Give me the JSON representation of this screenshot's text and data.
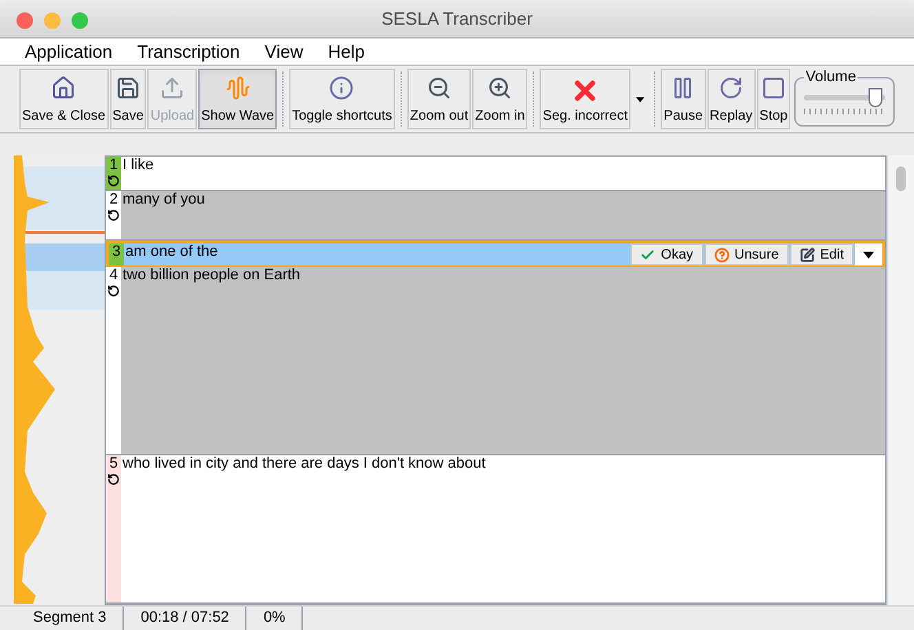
{
  "window": {
    "title": "SESLA Transcriber"
  },
  "menu": [
    "Application",
    "Transcription",
    "View",
    "Help"
  ],
  "toolbar": [
    {
      "label": "Save & Close",
      "disabled": false,
      "selected": false
    },
    {
      "label": "Save",
      "disabled": false,
      "selected": false
    },
    {
      "label": "Upload",
      "disabled": true,
      "selected": false
    },
    {
      "label": "Show Wave",
      "disabled": false,
      "selected": true
    },
    {
      "label": "Toggle shortcuts",
      "disabled": false,
      "selected": false
    },
    {
      "label": "Zoom out",
      "disabled": false,
      "selected": false
    },
    {
      "label": "Zoom in",
      "disabled": false,
      "selected": false
    },
    {
      "label": "Seg. incorrect",
      "disabled": false,
      "selected": false
    },
    {
      "label": "Pause",
      "disabled": false,
      "selected": false
    },
    {
      "label": "Replay",
      "disabled": false,
      "selected": false
    },
    {
      "label": "Stop",
      "disabled": false,
      "selected": false
    }
  ],
  "volume": {
    "label": "Volume",
    "level": 0.88
  },
  "segments": [
    {
      "number": "1",
      "text": "I like",
      "approved": true,
      "flagged": false,
      "shaded": false,
      "selected": false
    },
    {
      "number": "2",
      "text": "many of you",
      "approved": false,
      "flagged": false,
      "shaded": true,
      "selected": false
    },
    {
      "number": "3",
      "text": "am one of the",
      "approved": true,
      "flagged": false,
      "shaded": false,
      "selected": true
    },
    {
      "number": "4",
      "text": "two billion people on Earth",
      "approved": false,
      "flagged": false,
      "shaded": true,
      "selected": false
    },
    {
      "number": "5",
      "text": "who lived in city and there are days I don't know about",
      "approved": false,
      "flagged": true,
      "shaded": false,
      "selected": false
    }
  ],
  "segment_actions": [
    "Okay",
    "Unsure",
    "Edit"
  ],
  "status_bar": [
    "Segment 3",
    "00:18 / 07:52",
    "0%"
  ]
}
